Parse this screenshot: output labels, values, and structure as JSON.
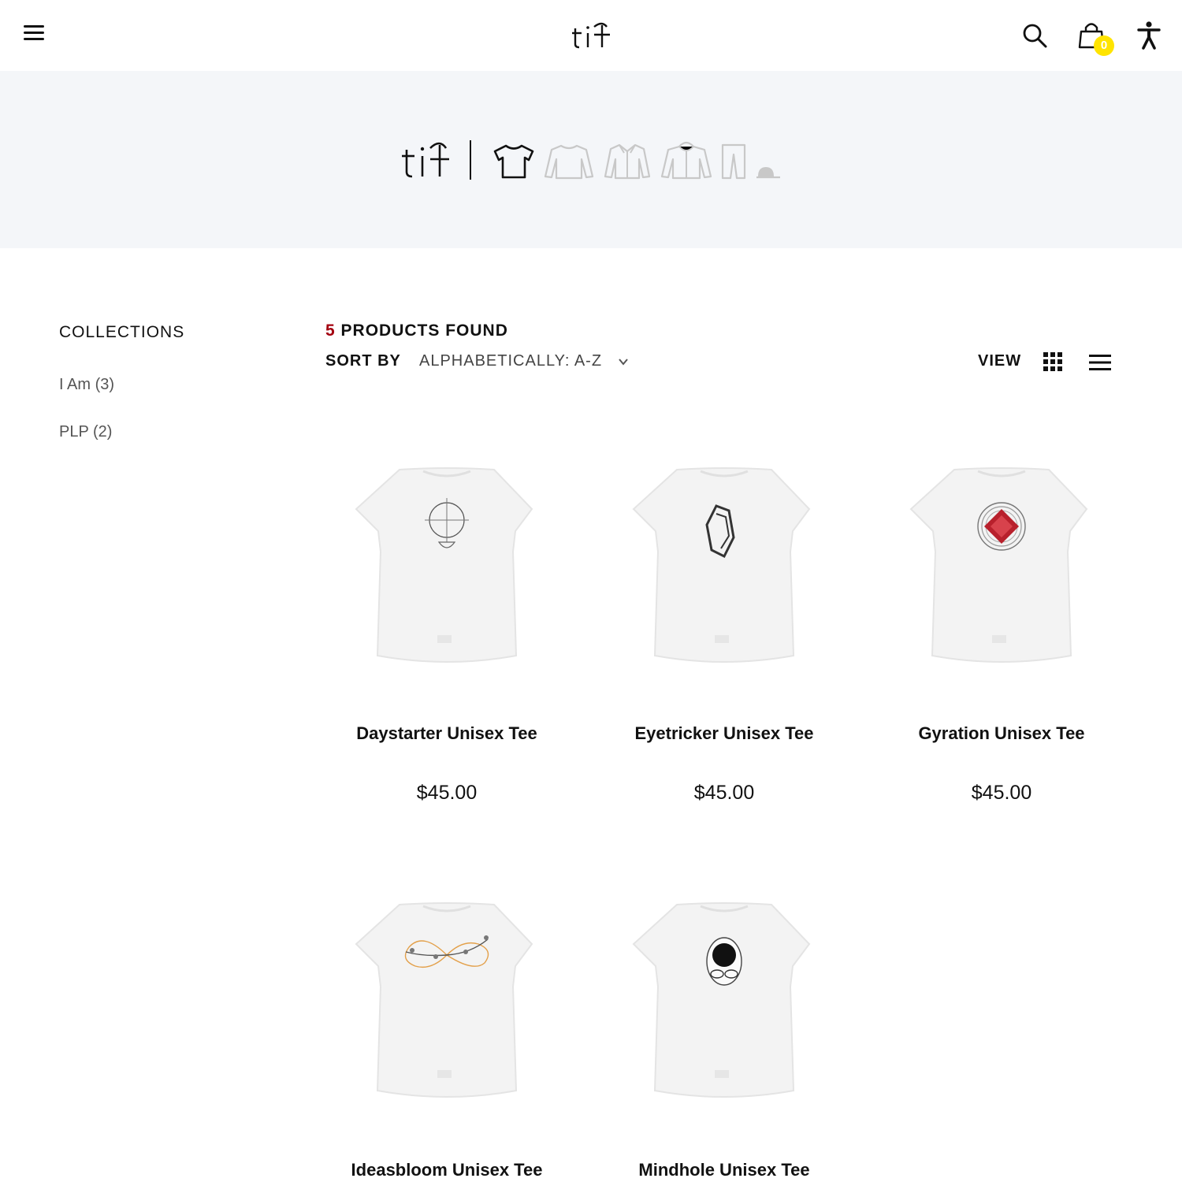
{
  "header": {
    "menu_icon": "hamburger-menu-icon",
    "logo_text": "tif",
    "search_icon": "search-icon",
    "cart_icon": "shopping-bag-icon",
    "cart_count": "0",
    "accessibility_icon": "accessibility-icon",
    "badge_color": "#ffe400"
  },
  "banner": {
    "logo_text": "tif",
    "categories": [
      {
        "name": "t-shirt-icon",
        "active": true
      },
      {
        "name": "sweater-icon",
        "active": false
      },
      {
        "name": "shirt-icon",
        "active": false
      },
      {
        "name": "hoodie-icon",
        "active": false
      },
      {
        "name": "pants-icon",
        "active": false
      },
      {
        "name": "cap-icon",
        "active": false
      }
    ]
  },
  "sidebar": {
    "title": "COLLECTIONS",
    "items": [
      {
        "label": "I Am (3)"
      },
      {
        "label": "PLP (2)"
      }
    ]
  },
  "toolbar": {
    "count": "5",
    "found_label": "PRODUCTS FOUND",
    "sort_label": "SORT BY",
    "sort_value": "ALPHABETICALLY: A-Z",
    "view_label": "VIEW",
    "count_color": "#a3000f"
  },
  "products": [
    {
      "name": "Daystarter Unisex Tee",
      "price": "$45.00",
      "graphic": "coffee-clock-graphic"
    },
    {
      "name": "Eyetricker Unisex Tee",
      "price": "$45.00",
      "graphic": "optical-illusion-graphic"
    },
    {
      "name": "Gyration Unisex Tee",
      "price": "$45.00",
      "graphic": "red-diamond-circles-graphic"
    },
    {
      "name": "Ideasbloom Unisex Tee",
      "price": "",
      "graphic": "infinity-branches-graphic"
    },
    {
      "name": "Mindhole Unisex Tee",
      "price": "",
      "graphic": "head-glasses-graphic"
    }
  ]
}
